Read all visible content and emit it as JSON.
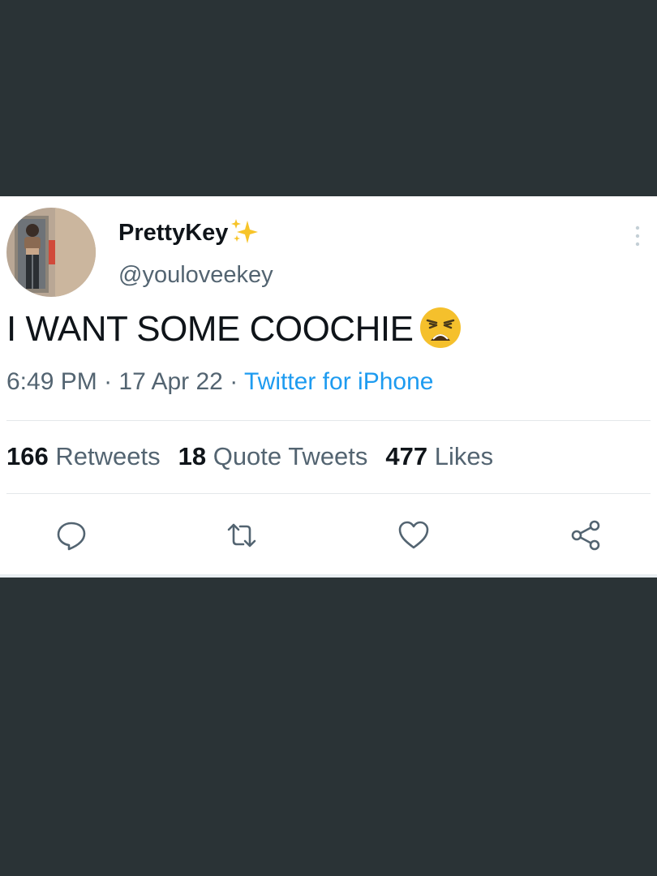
{
  "tweet": {
    "display_name": "PrettyKey",
    "name_emoji_icon": "sparkles-icon",
    "handle": "@youloveekey",
    "text": "I WANT SOME COOCHIE",
    "text_emoji_icon": "weary-face-icon",
    "time": "6:49 PM",
    "separator": "·",
    "date": "17 Apr 22",
    "source": "Twitter for iPhone",
    "stats": {
      "retweets_count": "166",
      "retweets_label": "Retweets",
      "quote_tweets_count": "18",
      "quote_tweets_label": "Quote Tweets",
      "likes_count": "477",
      "likes_label": "Likes"
    },
    "actions": [
      "reply-icon",
      "retweet-icon",
      "like-icon",
      "share-icon"
    ]
  },
  "colors": {
    "background": "#2a3336",
    "card": "#ffffff",
    "text_primary": "#0f1419",
    "text_secondary": "#536471",
    "accent": "#1d9bf0"
  }
}
